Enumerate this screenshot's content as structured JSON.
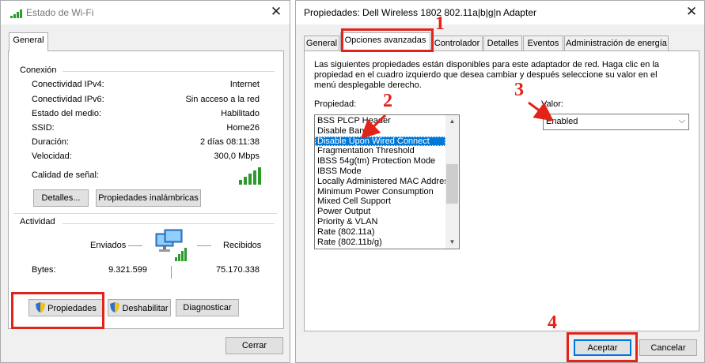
{
  "wifi_status": {
    "title": "Estado de Wi-Fi",
    "tab": "General",
    "connection_heading": "Conexión",
    "rows": [
      {
        "label": "Conectividad IPv4:",
        "value": "Internet"
      },
      {
        "label": "Conectividad IPv6:",
        "value": "Sin acceso a la red"
      },
      {
        "label": "Estado del medio:",
        "value": "Habilitado"
      },
      {
        "label": "SSID:",
        "value": "Home26"
      },
      {
        "label": "Duración:",
        "value": "2 días 08:11:38"
      },
      {
        "label": "Velocidad:",
        "value": "300,0 Mbps"
      }
    ],
    "signal_label": "Calidad de señal:",
    "details_button": "Detalles...",
    "wireless_props_button": "Propiedades inalámbricas",
    "activity_heading": "Actividad",
    "sent_label": "Enviados",
    "received_label": "Recibidos",
    "bytes_label": "Bytes:",
    "bytes_sent": "9.321.599",
    "bytes_received": "75.170.338",
    "properties_button": "Propiedades",
    "disable_button": "Deshabilitar",
    "diagnose_button": "Diagnosticar",
    "close_button": "Cerrar"
  },
  "adapter_props": {
    "title": "Propiedades: Dell Wireless 1802 802.11a|b|g|n Adapter",
    "tabs": [
      "General",
      "Opciones avanzadas",
      "Controlador",
      "Detalles",
      "Eventos",
      "Administración de energía"
    ],
    "description": "Las siguientes propiedades están disponibles para este adaptador de red. Haga clic en la propiedad en el cuadro izquierdo que desea cambiar y después seleccione su valor en el menú desplegable derecho.",
    "property_label": "Propiedad:",
    "value_label": "Valor:",
    "properties": [
      "BSS PLCP Header",
      "Disable Bands",
      "Disable Upon Wired Connect",
      "Fragmentation Threshold",
      "IBSS 54g(tm) Protection Mode",
      "IBSS Mode",
      "Locally Administered MAC Address",
      "Minimum Power Consumption",
      "Mixed Cell Support",
      "Power Output",
      "Priority & VLAN",
      "Rate (802.11a)",
      "Rate (802.11b/g)"
    ],
    "selected_property": "Disable Upon Wired Connect",
    "value_selected": "Enabled",
    "accept_button": "Aceptar",
    "cancel_button": "Cancelar"
  },
  "annotations": [
    "1",
    "2",
    "3",
    "4"
  ],
  "colors": {
    "accent": "#0078d7",
    "annotation": "#e2231a",
    "signal": "#2b9a2b"
  }
}
